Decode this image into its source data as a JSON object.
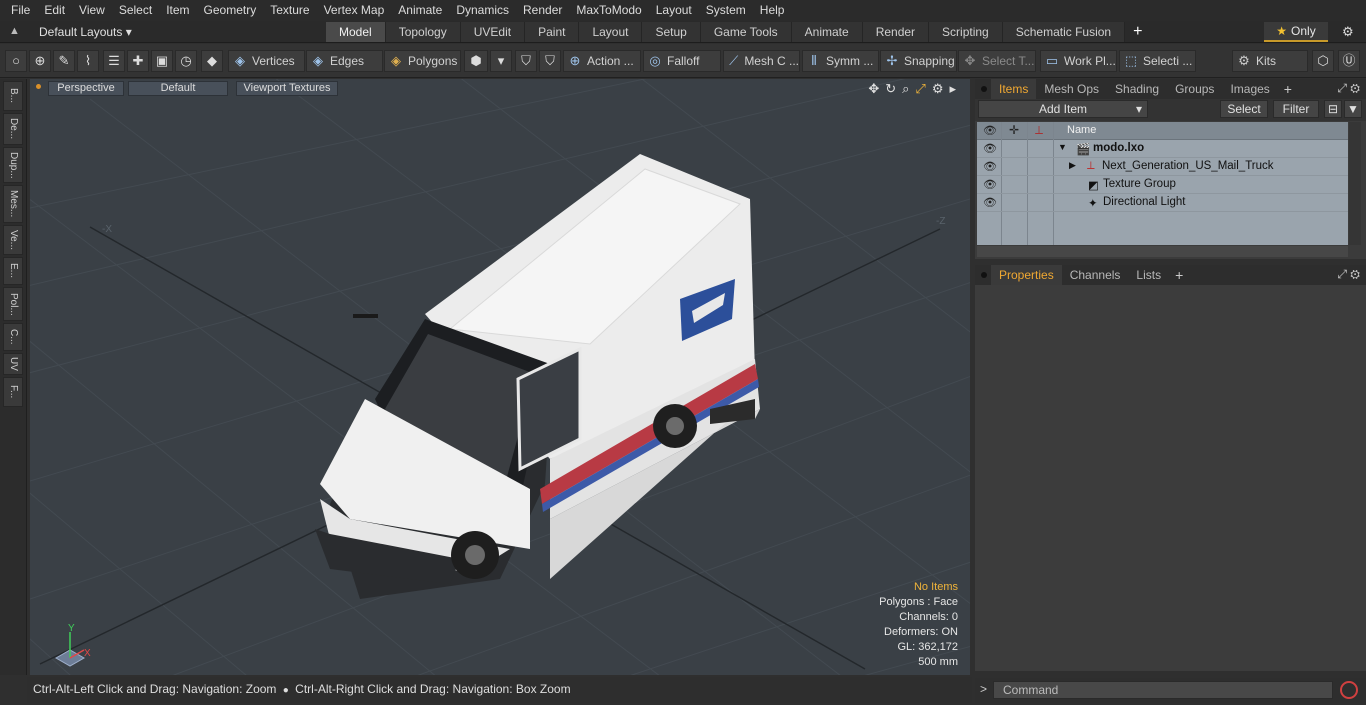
{
  "menu": [
    "File",
    "Edit",
    "View",
    "Select",
    "Item",
    "Geometry",
    "Texture",
    "Vertex Map",
    "Animate",
    "Dynamics",
    "Render",
    "MaxToModo",
    "Layout",
    "System",
    "Help"
  ],
  "layout": {
    "preset": "Default Layouts ▾",
    "tabs": [
      "Model",
      "Topology",
      "UVEdit",
      "Paint",
      "Layout",
      "Setup",
      "Game Tools",
      "Animate",
      "Render",
      "Scripting",
      "Schematic Fusion"
    ],
    "active_tab": "Model",
    "only_label": "Only"
  },
  "toolbar": {
    "vertices": "Vertices",
    "edges": "Edges",
    "polygons": "Polygons",
    "action": "Action ...",
    "falloff": "Falloff",
    "mesh": "Mesh C ...",
    "symm": "Symm ...",
    "snapping": "Snapping",
    "select_t": "Select T...",
    "work_pl": "Work Pl...",
    "selecti": "Selecti ...",
    "kits": "Kits"
  },
  "left_tabs": [
    "B...",
    "De...",
    "Dup...",
    "Mes...",
    "Ve...",
    "E...",
    "Pol...",
    "C...",
    "UV",
    "F..."
  ],
  "viewport": {
    "view_mode": "Perspective",
    "shading": "Default",
    "textures": "Viewport Textures",
    "info": {
      "selection": "No Items",
      "polygons": "Polygons : Face",
      "channels": "Channels: 0",
      "deformers": "Deformers: ON",
      "gl": "GL: 362,172",
      "scale": "500 mm"
    },
    "axis_labels": {
      "neg_x": "-X",
      "neg_z": "-Z",
      "gizmo_x": "X",
      "gizmo_y": "Y"
    }
  },
  "status": {
    "hint_left": "Ctrl-Alt-Left Click and Drag: Navigation: Zoom",
    "hint_right": "Ctrl-Alt-Right Click and Drag: Navigation: Box Zoom"
  },
  "items_panel": {
    "tabs": [
      "Items",
      "Mesh Ops",
      "Shading",
      "Groups",
      "Images"
    ],
    "active_tab": "Items",
    "add_item": "Add Item",
    "select": "Select",
    "filter": "Filter",
    "column_name": "Name",
    "rows": [
      {
        "label": "modo.lxo",
        "type": "scene"
      },
      {
        "label": "Next_Generation_US_Mail_Truck",
        "type": "mesh"
      },
      {
        "label": "Texture Group",
        "type": "texture"
      },
      {
        "label": "Directional Light",
        "type": "light"
      }
    ]
  },
  "properties_panel": {
    "tabs": [
      "Properties",
      "Channels",
      "Lists"
    ],
    "active_tab": "Properties"
  },
  "command": {
    "placeholder": "Command"
  },
  "colors": {
    "accent": "#f0a832",
    "viewport_bg": "#3a4046",
    "item_list_bg": "#9aa4ad"
  }
}
